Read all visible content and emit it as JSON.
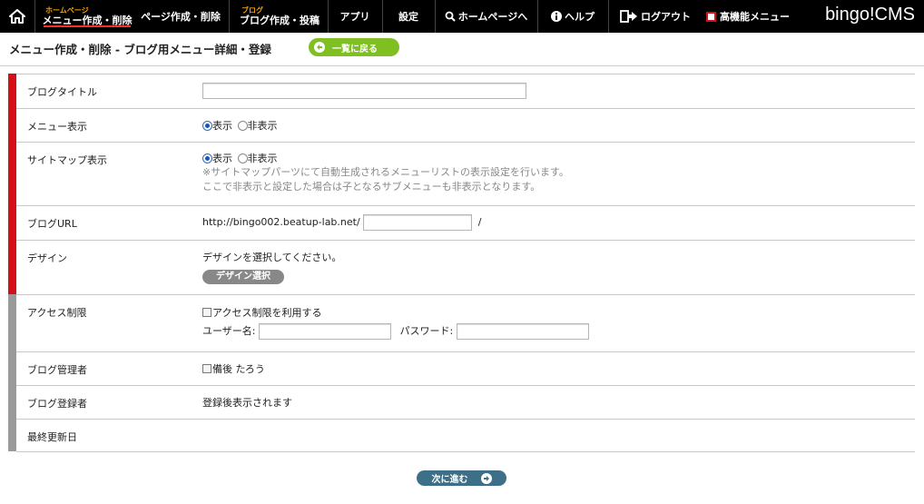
{
  "nav": {
    "brand": "bingo!CMS",
    "items": [
      {
        "sub": "ホームページ",
        "label": "メニュー作成・削除"
      },
      {
        "sub": "",
        "label": "ページ作成・削除"
      },
      {
        "sub": "ブログ",
        "label": "ブログ作成・投稿"
      },
      {
        "sub": "",
        "label": "アプリ"
      },
      {
        "sub": "",
        "label": "設定"
      },
      {
        "sub": "",
        "label": "ホームページへ"
      },
      {
        "sub": "",
        "label": "ヘルプ"
      },
      {
        "sub": "",
        "label": "ログアウト"
      },
      {
        "sub": "",
        "label": "高機能メニュー"
      }
    ]
  },
  "header": {
    "title": "メニュー作成・削除 - ブログ用メニュー詳細・登録",
    "back_label": "一覧に戻る"
  },
  "form": {
    "blog_title": {
      "label": "ブログタイトル",
      "value": ""
    },
    "menu_display": {
      "label": "メニュー表示",
      "opt_show": "表示",
      "opt_hide": "非表示",
      "selected": "表示"
    },
    "sitemap_display": {
      "label": "サイトマップ表示",
      "opt_show": "表示",
      "opt_hide": "非表示",
      "selected": "表示",
      "note1": "※サイトマップパーツにて自動生成されるメニューリストの表示設定を行います。",
      "note2": "ここで非表示と設定した場合は子となるサブメニューも非表示となります。"
    },
    "blog_url": {
      "label": "ブログURL",
      "prefix": "http://bingo002.beatup-lab.net/",
      "value": "",
      "suffix": "/"
    },
    "design": {
      "label": "デザイン",
      "text": "デザインを選択してください。",
      "button": "デザイン選択"
    },
    "access": {
      "label": "アクセス制限",
      "checkbox": "アクセス制限を利用する",
      "user_label": "ユーザー名:",
      "user_value": "",
      "pass_label": "パスワード:",
      "pass_value": ""
    },
    "admin": {
      "label": "ブログ管理者",
      "checkbox": "備後 たろう"
    },
    "registrant": {
      "label": "ブログ登録者",
      "value": "登録後表示されます"
    },
    "last_updated": {
      "label": "最終更新日",
      "value": ""
    }
  },
  "footer": {
    "next_label": "次に進む"
  },
  "colors": {
    "accent_red": "#d30f17",
    "green": "#7fbf21",
    "next_blue": "#3d6f88",
    "nav_bg": "#000000"
  }
}
